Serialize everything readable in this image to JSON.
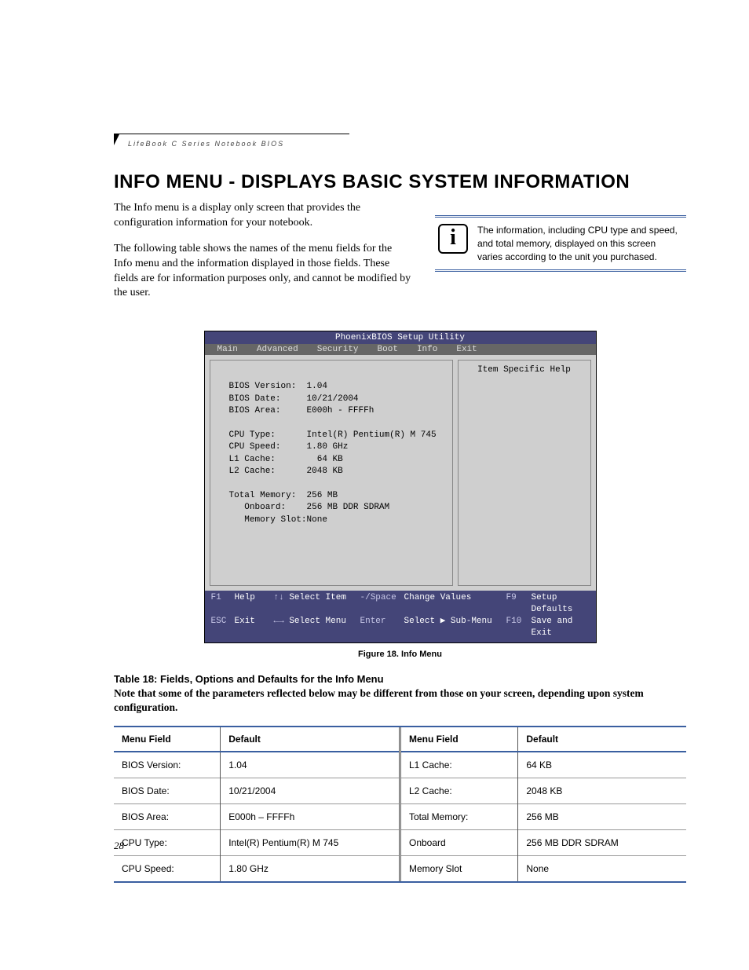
{
  "running_head": "LifeBook C Series Notebook BIOS",
  "section_title": "INFO MENU - DISPLAYS BASIC SYSTEM INFORMATION",
  "intro_p1": "The Info menu is a display only screen that provides the configuration information for your notebook.",
  "intro_p2": "The following table shows the names of the menu fields for the Info menu and the information displayed in those fields. These fields are for information purposes only, and cannot be modified by the user.",
  "info_note": "The information, including CPU type and speed, and total memory, displayed on this screen varies according to the unit you purchased.",
  "bios": {
    "title": "PhoenixBIOS Setup Utility",
    "menu": [
      "Main",
      "Advanced",
      "Security",
      "Boot",
      "Info",
      "Exit"
    ],
    "help_title": "Item Specific Help",
    "rows": [
      {
        "label": "BIOS Version:",
        "value": "1.04"
      },
      {
        "label": "BIOS Date:",
        "value": "10/21/2004"
      },
      {
        "label": "BIOS Area:",
        "value": "E000h - FFFFh"
      },
      {
        "label": "",
        "value": ""
      },
      {
        "label": "CPU Type:",
        "value": "Intel(R) Pentium(R) M 745"
      },
      {
        "label": "CPU Speed:",
        "value": "1.80 GHz"
      },
      {
        "label": "L1 Cache:",
        "value": "  64 KB"
      },
      {
        "label": "L2 Cache:",
        "value": "2048 KB"
      },
      {
        "label": "",
        "value": ""
      },
      {
        "label": "Total Memory:",
        "value": "256 MB"
      },
      {
        "label": "   Onboard:",
        "value": "256 MB DDR SDRAM"
      },
      {
        "label": "   Memory Slot:",
        "value": "None"
      }
    ],
    "footer": {
      "r1": {
        "k1": "F1",
        "a1": "Help",
        "k2": "↑↓",
        "a2": "Select Item",
        "k3": "-/Space",
        "a3": "Change Values",
        "k4": "F9",
        "a4": "Setup Defaults"
      },
      "r2": {
        "k1": "ESC",
        "a1": "Exit",
        "k2": "←→",
        "a2": "Select Menu",
        "k3": "Enter",
        "a3": "Select ▶ Sub-Menu",
        "k4": "F10",
        "a4": "Save and Exit"
      }
    }
  },
  "figure_caption": "Figure 18.  Info Menu",
  "table_title": "Table 18: Fields, Options and Defaults for the Info Menu",
  "table_note": "Note that some of the parameters reflected below may be different from those on your screen, depending upon system configuration.",
  "table": {
    "headers": {
      "field": "Menu Field",
      "default": "Default"
    },
    "left": [
      {
        "field": "BIOS Version:",
        "default": "1.04"
      },
      {
        "field": "BIOS Date:",
        "default": "10/21/2004"
      },
      {
        "field": "BIOS Area:",
        "default": "E000h – FFFFh"
      },
      {
        "field": "CPU Type:",
        "default": "Intel(R) Pentium(R) M 745"
      },
      {
        "field": "CPU Speed:",
        "default": "1.80 GHz"
      }
    ],
    "right": [
      {
        "field": "L1 Cache:",
        "default": "64 KB"
      },
      {
        "field": "L2 Cache:",
        "default": "2048 KB"
      },
      {
        "field": "Total Memory:",
        "default": "256 MB"
      },
      {
        "field": "Onboard",
        "default": "256 MB DDR SDRAM"
      },
      {
        "field": "Memory Slot",
        "default": "None"
      }
    ]
  },
  "page_number": "28"
}
